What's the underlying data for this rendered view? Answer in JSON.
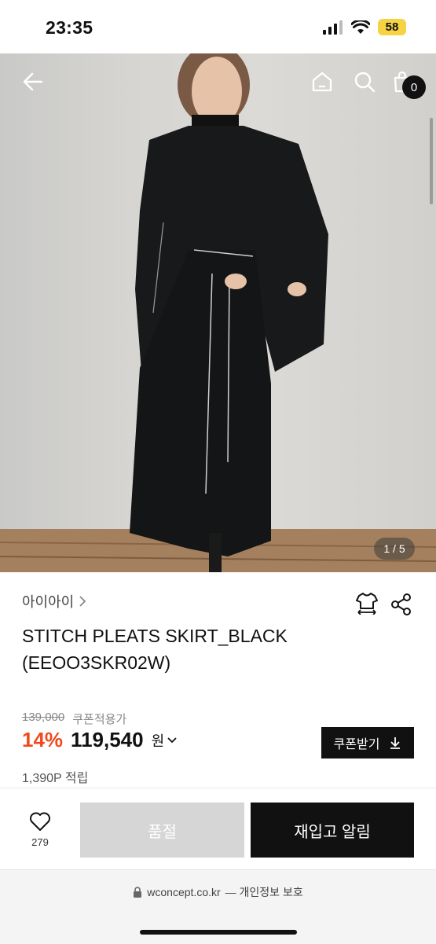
{
  "status_bar": {
    "time": "23:35",
    "battery": "58"
  },
  "header": {
    "cart_count": "0"
  },
  "image": {
    "counter": "1 / 5"
  },
  "product": {
    "brand": "아이아이",
    "title_line1": "STITCH PLEATS SKIRT_BLACK",
    "title_line2": "(EEOO3SKR02W)",
    "original_price": "139,000",
    "coupon_note": "쿠폰적용가",
    "discount": "14%",
    "price": "119,540",
    "currency": "원",
    "points": "1,390P 적립"
  },
  "buttons": {
    "coupon": "쿠폰받기",
    "soldout": "품절",
    "restock": "재입고 알림"
  },
  "like": {
    "count": "279"
  },
  "browser": {
    "domain": "wconcept.co.kr",
    "privacy": "— 개인정보 보호"
  },
  "colors": {
    "discount": "#f04a1d",
    "battery": "#f5d343"
  }
}
